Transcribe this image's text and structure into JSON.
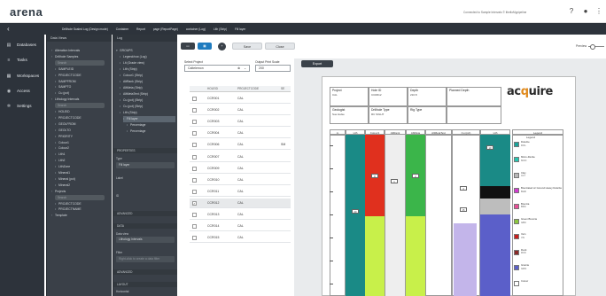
{
  "app": {
    "logo": "arena",
    "status": "Connected to Sample Intervals © lthelloMypipeline"
  },
  "breadcrumbs": [
    "Drillhole Scaled Log (Design mode)",
    "Container",
    "Report",
    "page (ReportPage)",
    "container (Log)",
    "Lith (Strip)",
    "Fill layer"
  ],
  "nav": [
    {
      "icon": "database-icon",
      "label": "Databases"
    },
    {
      "icon": "tasks-icon",
      "label": "Tasks"
    },
    {
      "icon": "workspaces-icon",
      "label": "Workspaces"
    },
    {
      "icon": "access-icon",
      "label": "Access"
    },
    {
      "icon": "settings-icon",
      "label": "Settings"
    }
  ],
  "data_views": {
    "title": "Data Views",
    "items": [
      "Alteration Intervals",
      "Drillhole Samples",
      "Search",
      "SAMPLEID",
      "PROJECTCODE",
      "SAMPFROM",
      "SAMPTO",
      "Cu (pct)",
      "Lithology Intervals",
      "Search",
      "HOLEID",
      "PROJECTCODE",
      "GEOLFROM",
      "GEOLTO",
      "PRIORITY",
      "Colour1",
      "Colour2",
      "Lith1",
      "Lith2",
      "LithZone",
      "Mineral1",
      "Mineral (pct)",
      "Mineral2",
      "Projects",
      "Search",
      "PROJECTCODE",
      "PROJECTNAME",
      "Template"
    ]
  },
  "log_tree": {
    "title": "Log",
    "items": [
      "GROUPS",
      "Legend/row (Log)",
      "Lit (Grade view)",
      "Lith (Strip)",
      "Colour1 (Strip)",
      "AltRank (Strip)",
      "AltMeta (Strip)",
      "AltMetaText (Strip)",
      "Cu (pct) (Strip)",
      "Cu (pct) (Strip)",
      "Lith (Strip)",
      "Fill layer",
      "Percentage",
      "Percentage"
    ]
  },
  "properties": {
    "section": "PROPERTIES",
    "type_label": "Type",
    "type_value": "Fill layer",
    "label_label": "Label",
    "id_label": "ID",
    "advanced": "ADVANCED",
    "data": "DATA",
    "data_view_label": "Data view",
    "data_view_value": "Lithology Intervals",
    "filter_label": "Filter",
    "filter_placeholder": "Right-click to create a data filter",
    "layout": "LAYOUT",
    "horizontal": "Horizontal"
  },
  "toolbar": {
    "save": "Save",
    "close": "Close",
    "zoom_label": "Preview"
  },
  "select_project": {
    "label": "Select Project",
    "value": "Caltelemon"
  },
  "print_scale": {
    "label": "Output Print Scale",
    "value": "200"
  },
  "grid": {
    "columns": [
      "HOLEID",
      "PROJECTCODE",
      "SE"
    ],
    "rows": [
      {
        "holeid": "CCR001",
        "project": "CAL",
        "extra": "",
        "checked": false
      },
      {
        "holeid": "CCR002",
        "project": "CAL",
        "extra": "",
        "checked": false
      },
      {
        "holeid": "CCR003",
        "project": "CAL",
        "extra": "",
        "checked": false
      },
      {
        "holeid": "CCR004",
        "project": "CAL",
        "extra": "",
        "checked": false
      },
      {
        "holeid": "CCR006",
        "project": "CAL",
        "extra": "SM",
        "checked": false
      },
      {
        "holeid": "CCR007",
        "project": "CAL",
        "extra": "",
        "checked": false
      },
      {
        "holeid": "CCR009",
        "project": "CAL",
        "extra": "",
        "checked": false
      },
      {
        "holeid": "CCR010",
        "project": "CAL",
        "extra": "",
        "checked": false
      },
      {
        "holeid": "CCR011",
        "project": "CAL",
        "extra": "",
        "checked": false
      },
      {
        "holeid": "CCR012",
        "project": "CAL",
        "extra": "",
        "checked": true
      },
      {
        "holeid": "CCR013",
        "project": "CAL",
        "extra": "",
        "checked": false
      },
      {
        "holeid": "CCR014",
        "project": "CAL",
        "extra": "",
        "checked": false
      },
      {
        "holeid": "CCR015",
        "project": "CAL",
        "extra": "",
        "checked": false
      }
    ]
  },
  "report": {
    "export": "Export",
    "header": {
      "project_label": "Project",
      "project_value": "CAL",
      "hole_label": "Hole ID",
      "hole_value": "CCR012",
      "depth_label": "Depth",
      "depth_value": "210.8",
      "planned_label": "Planned Depth",
      "geologist_label": "Geologist",
      "geologist_value": "Sue Helse",
      "drilltype_label": "Drillhole Type",
      "drilltype_value": "RC SIGHT",
      "rig_label": "Rig Type"
    },
    "logo": {
      "pre": "ac",
      "mid": "q",
      "post": "uire"
    },
    "columns": [
      "m",
      "Lith",
      "Colour1",
      "AltRank",
      "AltMeta",
      "AltMetaText",
      "Cu (pct)",
      "Lith",
      "Legend"
    ],
    "values": [
      "20",
      "8",
      "1",
      "2",
      "4",
      "15",
      "10"
    ],
    "legend": [
      {
        "label": "Dolerite",
        "code": "DOL",
        "color": "#1aa39a"
      },
      {
        "label": "Micro-Diorite",
        "code": "MCD",
        "color": "#26c6b0"
      },
      {
        "label": "Clay",
        "code": "CLY",
        "color": "#b7b7b7"
      },
      {
        "label": "Brecciated w/ Ground Heavy Dolerite",
        "code": "BHD",
        "color": "#d33ad1"
      },
      {
        "label": "Breccia",
        "code": "BRC",
        "color": "#e84f97"
      },
      {
        "label": "Green Breccia",
        "code": "GBC",
        "color": "#8cc63f"
      },
      {
        "label": "Vein",
        "code": "VN",
        "color": "#c81e1e"
      },
      {
        "label": "Rock",
        "code": "RCK",
        "color": "#8a2a2a"
      },
      {
        "label": "Granite",
        "code": "GRN",
        "color": "#5b5fc9"
      },
      {
        "label": "Colour",
        "code": "",
        "color": "#ffffff"
      }
    ]
  },
  "colors": {
    "dark_panel": "#2d333b",
    "accent_blue": "#1e7bbf",
    "lith_teal": "#1a8a86",
    "colour_red": "#e0301e",
    "colour_lime": "#c8f04a",
    "green": "#3bb54a",
    "purple": "#5b5fc9"
  }
}
